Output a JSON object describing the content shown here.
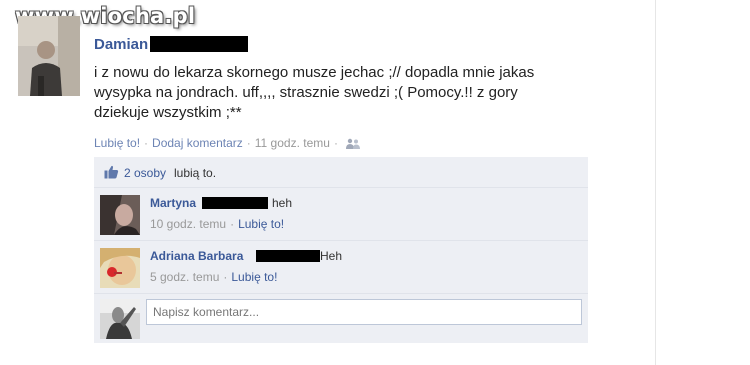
{
  "watermark": "www.wiocha.pl",
  "post": {
    "author": "Damian",
    "lines": [
      "i z nowu do lekarza skornego musze jechac ;// dopadla mnie jakas",
      "wysypka na jondrach. uff,,,, strasznie swedzi ;( Pomocy.!! z gory",
      "dziekuje wszystkim ;**"
    ],
    "actions": {
      "like": "Lubię to!",
      "comment": "Dodaj komentarz",
      "time": "11 godz. temu",
      "separator": "·"
    }
  },
  "likes": {
    "count_link": "2 osoby",
    "text": "lubią to."
  },
  "comments": [
    {
      "author": "Martyna",
      "text": "heh",
      "time": "10 godz. temu",
      "like": "Lubię to!",
      "separator": "·"
    },
    {
      "author": "Adriana Barbara",
      "text": "Heh",
      "time": "5 godz. temu",
      "like": "Lubię to!",
      "separator": "·"
    }
  ],
  "reply": {
    "placeholder": "Napisz komentarz..."
  },
  "colors": {
    "link": "#3b5998",
    "panel_bg": "#edeff4",
    "border": "#bdc7d8"
  },
  "icons": {
    "like": "thumbs-up-icon",
    "audience": "friends-icon"
  }
}
